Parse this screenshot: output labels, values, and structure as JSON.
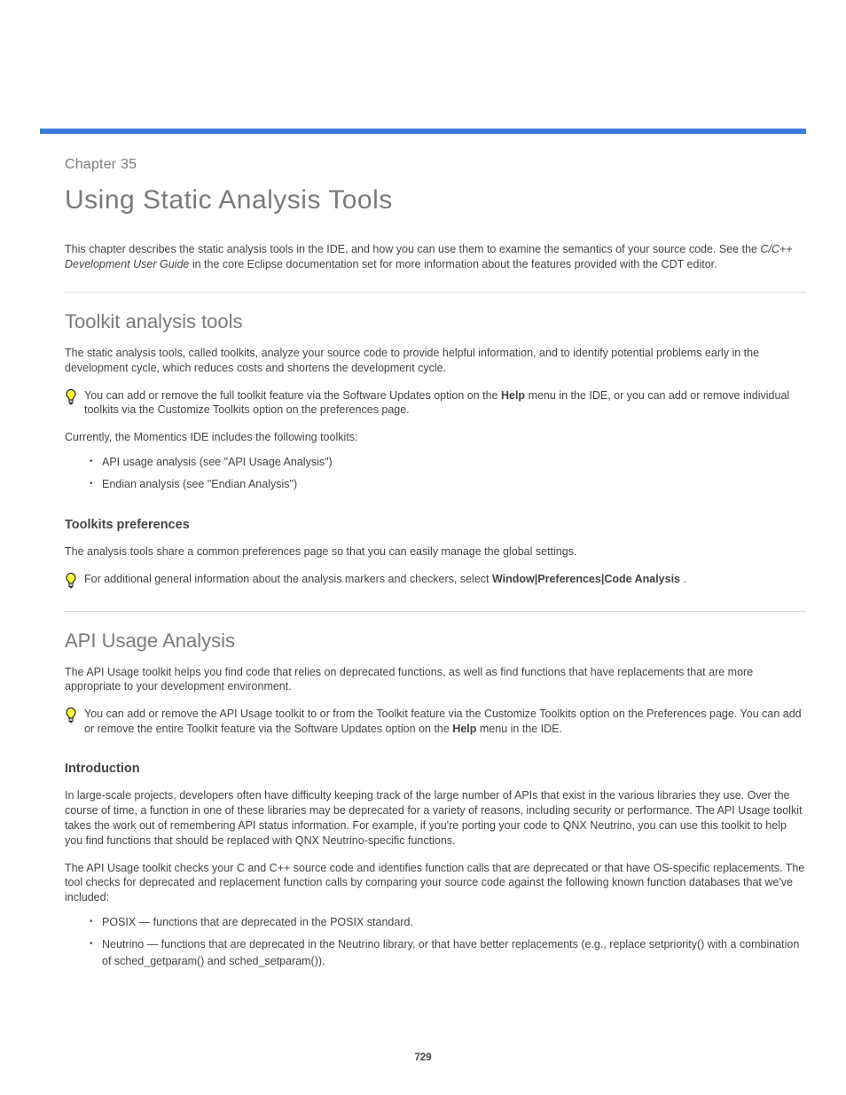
{
  "chapter": {
    "label": "Chapter 35",
    "title": "Using Static Analysis Tools"
  },
  "intro": {
    "line1_prefix": "This chapter describes the static analysis tools in the IDE, and how you can use them to examine the semantics of your source code. See the ",
    "line1_ref": "C/C++ Development User Guide",
    "line1_suffix": " in the core Eclipse documentation set for more information about the features provided with the CDT editor."
  },
  "section_toolkit": {
    "title": "Toolkit analysis tools",
    "p1": "The static analysis tools, called toolkits, analyze your source code to provide helpful information, and to identify potential problems early in the development cycle, which reduces costs and shortens the development cycle.",
    "tip1_prefix": "You can add or remove the full toolkit feature via the Software Updates option on the ",
    "tip1_bold": "Help",
    "tip1_suffix": " menu in the IDE, or you can add or remove individual toolkits via the Customize Toolkits option on the preferences page.",
    "p2": "Currently, the Momentics IDE includes the following toolkits:",
    "bullets": [
      "API usage analysis (see \"API Usage Analysis\")",
      "Endian analysis (see \"Endian Analysis\")"
    ],
    "sub_prefs_title": "Toolkits preferences",
    "sub_prefs_p": "The analysis tools share a common preferences page so that you can easily manage the global settings.",
    "tip2_prefix": "For additional general information about the analysis markers and checkers, select ",
    "tip2_bold": "Window|Preferences|Code Analysis",
    "tip2_suffix": "."
  },
  "section_api": {
    "title": "API Usage Analysis",
    "p1": "The API Usage toolkit helps you find code that relies on deprecated functions, as well as find functions that have replacements that are more appropriate to your development environment.",
    "tip_prefix": "You can add or remove the API Usage toolkit to or from the Toolkit feature via the Customize Toolkits option on the Preferences page. You can add or remove the entire Toolkit feature via the Software Updates option on the ",
    "tip_bold": "Help",
    "tip_suffix": " menu in the IDE.",
    "sub_intro_title": "Introduction",
    "sub_intro_p1": "In large-scale projects, developers often have difficulty keeping track of the large number of APIs that exist in the various libraries they use. Over the course of time, a function in one of these libraries may be deprecated for a variety of reasons, including security or performance. The API Usage toolkit takes the work out of remembering API status information. For example, if you're porting your code to QNX Neutrino, you can use this toolkit to help you find functions that should be replaced with QNX Neutrino-specific functions.",
    "sub_intro_p2": "The API Usage toolkit checks your C and C++ source code and identifies function calls that are deprecated or that have OS-specific replacements. The tool checks for deprecated and replacement function calls by comparing your source code against the following known function databases that we've included:",
    "bullets": [
      "POSIX — functions that are deprecated in the POSIX standard.",
      "Neutrino — functions that are deprecated in the Neutrino library, or that have better replacements (e.g., replace setpriority() with a combination of sched_getparam() and sched_setparam())."
    ]
  },
  "page_number": "729"
}
